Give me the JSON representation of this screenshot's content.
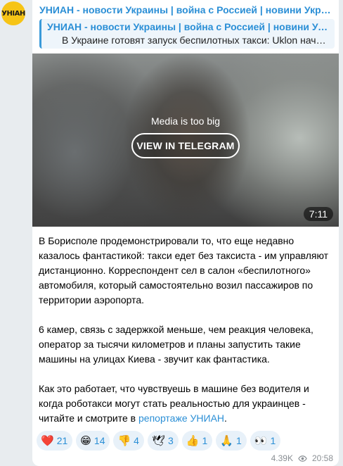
{
  "avatar": {
    "text": "УНІАН",
    "color": "#f6c416"
  },
  "message": {
    "channel_title": "УНИАН - новости Украины | война с Россией | новини України | війна з Росією",
    "reply": {
      "title": "УНИАН - новости Украины | война с Россией | новини України | війна з Росією",
      "text": "В Украине готовят запуск беспилотных такси: Uklon начал тестирование"
    },
    "media": {
      "note": "Media is too big",
      "button_label": "VIEW IN TELEGRAM",
      "duration": "7:11"
    },
    "paragraphs": [
      "В Борисполе продемонстрировали то, что еще недавно казалось фантастикой: такси едет без таксиста - им управляют дистанционно. Корреспондент сел в салон «беспилотного» автомобиля, который самостоятельно возил пассажиров по территории аэропорта.",
      "6 камер, связь с задержкой меньше, чем реакция человека, оператор за тысячи километров и планы запустить такие машины на улицах Киева - звучит как фантастика."
    ],
    "last_paragraph": {
      "text": "Как это работает, что чувствуешь в машине без водителя и когда роботакси могут стать реальностью для украинцев - читайте и смотрите в ",
      "link": "репортаже УНИАН",
      "suffix": "."
    },
    "reactions": [
      {
        "emoji": "❤️",
        "icon": "heart-icon",
        "count": "21"
      },
      {
        "emoji": "😁",
        "icon": "grin-icon",
        "count": "14"
      },
      {
        "emoji": "👎",
        "icon": "thumbs-down-icon",
        "count": "4"
      },
      {
        "emoji": "🕊",
        "icon": "dove-icon",
        "count": "3"
      },
      {
        "emoji": "👍",
        "icon": "thumbs-up-icon",
        "count": "1"
      },
      {
        "emoji": "🙏",
        "icon": "pray-icon",
        "count": "1"
      },
      {
        "emoji": "👀",
        "icon": "eyes-icon",
        "count": "1"
      }
    ],
    "views": "4.39K",
    "time": "20:58"
  },
  "colors": {
    "accent": "#2b8fd6",
    "background": "#e8ecef",
    "bubble": "#ffffff"
  }
}
